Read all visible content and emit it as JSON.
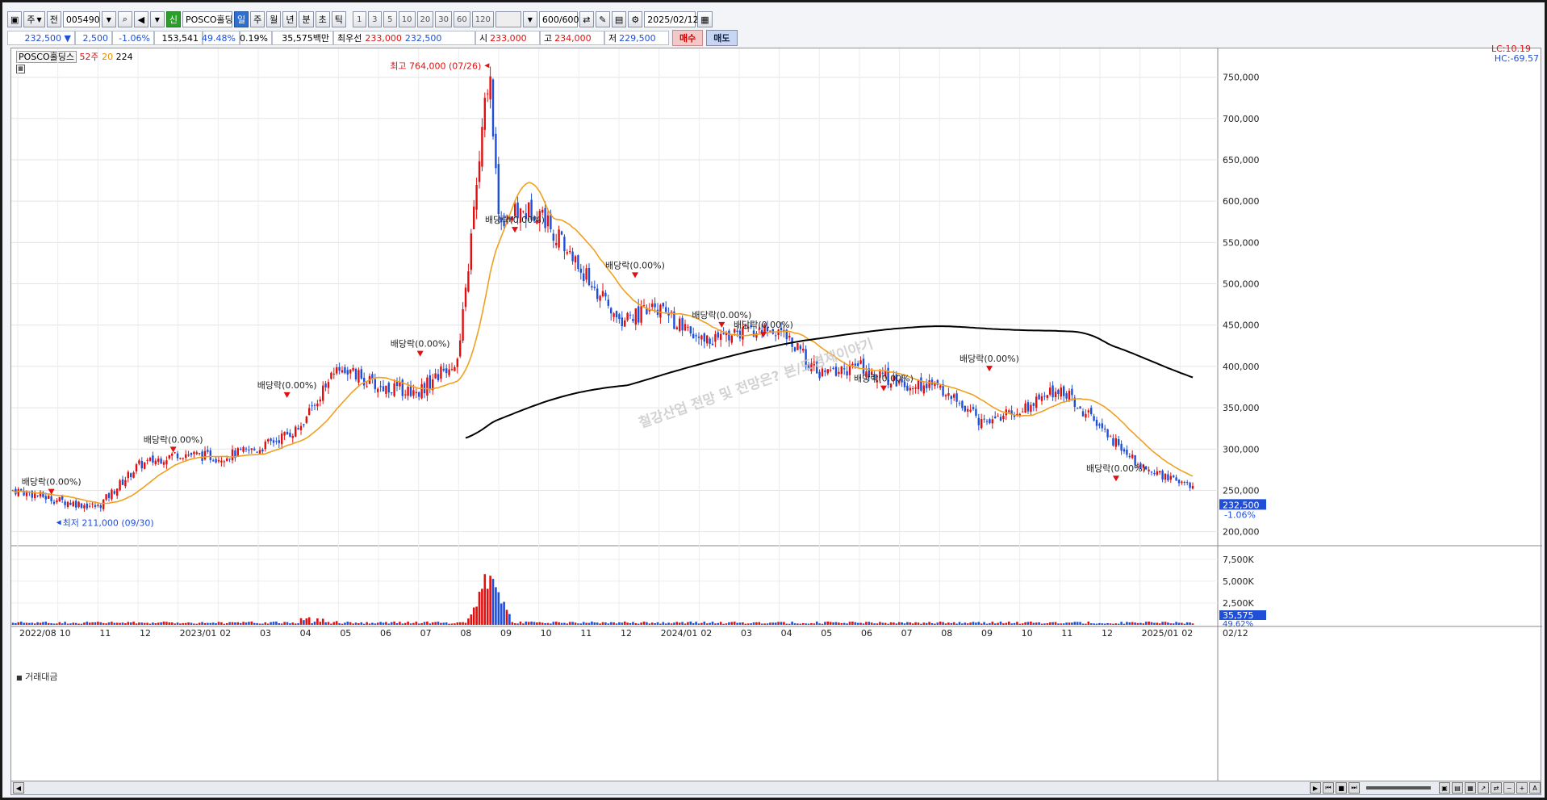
{
  "toolbar": {
    "mode1": "주",
    "mode2": "전",
    "code": "005490",
    "name": "POSCO홀딩스",
    "badge": "신",
    "periods": [
      "일",
      "주",
      "월",
      "년",
      "분",
      "초",
      "틱"
    ],
    "active_period": "일",
    "nums": [
      "1",
      "3",
      "5",
      "10",
      "20",
      "30",
      "60",
      "120"
    ],
    "count": "600/600",
    "date": "2025/02/12"
  },
  "quote": {
    "price": "232,500",
    "arrow": "▼",
    "change": "2,500",
    "change_pct": "-1.06%",
    "volume": "153,541",
    "ratio": "49.48%",
    "turnover": "0.19%",
    "amount": "35,575백만",
    "best_label": "최우선",
    "best_bid": "233,000",
    "best_ask": "232,500",
    "open_label": "시",
    "open": "233,000",
    "high_label": "고",
    "high": "234,000",
    "low_label": "저",
    "low": "229,500",
    "buy": "매수",
    "sell": "매도"
  },
  "legend": {
    "name": "POSCO홀딩스",
    "ma1": "52주",
    "ma2": "20",
    "ma3": "224",
    "volume_title": "거래대금"
  },
  "right_top": {
    "lc": "LC:10.19",
    "hc": "HC:-69.57"
  },
  "annotations": {
    "high": "최고 764,000 (07/26)",
    "low": "최저 211,000 (09/30)",
    "dividend": "배당락(0.00%)",
    "watermark": "철강산업 전망 및 전망은? 본/도경제이야기"
  },
  "price_tag": {
    "price": "232,500",
    "pct": "-1.06%"
  },
  "vol_tag": {
    "value": "35,575",
    "pct": "49.62%"
  },
  "colors": {
    "up": "#e01010",
    "down": "#1f4fd8",
    "ma20": "#f0a020",
    "ma224": "#000000"
  },
  "chart_data": {
    "type": "candlestick",
    "ylim": [
      185000,
      775000
    ],
    "y_ticks": [
      "750,000",
      "700,000",
      "650,000",
      "600,000",
      "550,000",
      "500,000",
      "450,000",
      "400,000",
      "350,000",
      "300,000",
      "250,000",
      "200,000"
    ],
    "vol_ticks": [
      "7,500K",
      "5,000K",
      "2,500K"
    ],
    "x_ticks": [
      "2022/08",
      "10",
      "11",
      "12",
      "2023/01",
      "02",
      "03",
      "04",
      "05",
      "06",
      "07",
      "08",
      "09",
      "10",
      "11",
      "12",
      "2024/01",
      "02",
      "03",
      "04",
      "05",
      "06",
      "07",
      "08",
      "09",
      "10",
      "11",
      "12",
      "2025/01",
      "02"
    ],
    "x_end_label": "02/12",
    "close_approx": [
      [
        "2022/08",
        250000
      ],
      [
        "2022/09",
        238000
      ],
      [
        "2022/10",
        230000
      ],
      [
        "2022/11",
        280000
      ],
      [
        "2022/12",
        295000
      ],
      [
        "2023/01",
        290000
      ],
      [
        "2023/02",
        300000
      ],
      [
        "2023/03",
        325000
      ],
      [
        "2023/04",
        400000
      ],
      [
        "2023/05",
        375000
      ],
      [
        "2023/06",
        370000
      ],
      [
        "2023/07",
        410000
      ],
      [
        "2023/07-26",
        764000
      ],
      [
        "2023/08",
        580000
      ],
      [
        "2023/09",
        590000
      ],
      [
        "2023/10",
        520000
      ],
      [
        "2023/11",
        455000
      ],
      [
        "2023/12",
        470000
      ],
      [
        "2024/01",
        430000
      ],
      [
        "2024/02",
        440000
      ],
      [
        "2024/03",
        445000
      ],
      [
        "2024/04",
        390000
      ],
      [
        "2024/05",
        400000
      ],
      [
        "2024/06",
        380000
      ],
      [
        "2024/07",
        375000
      ],
      [
        "2024/08",
        335000
      ],
      [
        "2024/09",
        345000
      ],
      [
        "2024/10",
        375000
      ],
      [
        "2024/11",
        325000
      ],
      [
        "2024/12",
        280000
      ],
      [
        "2025/01",
        260000
      ],
      [
        "2025/02",
        232500
      ]
    ]
  }
}
